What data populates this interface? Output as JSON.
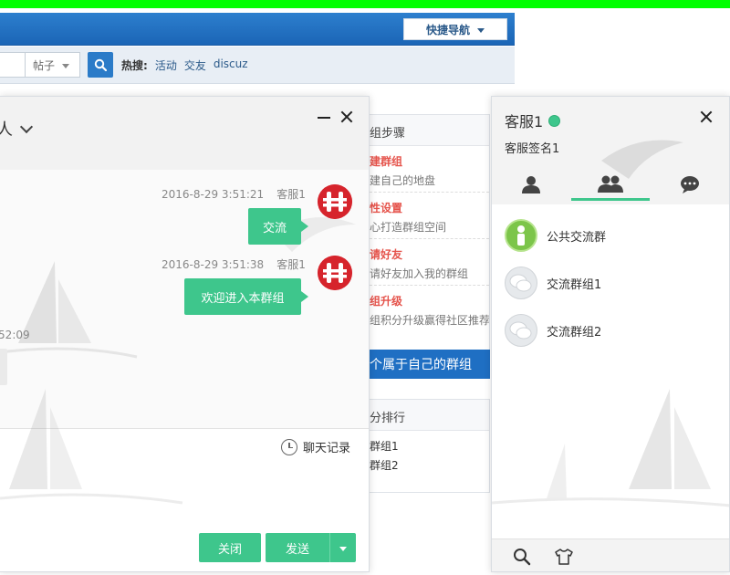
{
  "forum": {
    "quick_nav_label": "快捷导航",
    "search_scope": "帖子",
    "hot_label": "热搜:",
    "hot_links": [
      "活动",
      "交友",
      "discuz"
    ]
  },
  "steps": {
    "header": "组步骤",
    "items": [
      {
        "title": "建群组",
        "desc": "建自己的地盘"
      },
      {
        "title": "性设置",
        "desc": "心打造群组空间"
      },
      {
        "title": "请好友",
        "desc": "请好友加入我的群组"
      },
      {
        "title": "组升级",
        "desc": "组积分升级赢得社区推荐"
      }
    ],
    "create_button": "个属于自己的群组"
  },
  "ranking": {
    "header": "分排行",
    "items": [
      "群组1",
      "群组2"
    ]
  },
  "chat": {
    "title": "人",
    "messages": [
      {
        "time": "2016-8-29 3:51:21",
        "sender": "客服1",
        "text": "交流"
      },
      {
        "time": "2016-8-29 3:51:38",
        "sender": "客服1",
        "text": "欢迎进入本群组"
      }
    ],
    "older_time": ":52:09",
    "history_label": "聊天记录",
    "close_label": "关闭",
    "send_label": "发送"
  },
  "contact_panel": {
    "name": "客服1",
    "signature": "客服签名1",
    "groups": [
      "公共交流群",
      "交流群组1",
      "交流群组2"
    ]
  },
  "colors": {
    "accent_green": "#3ec68c",
    "forum_blue": "#1f6fc3",
    "step_red": "#e5534b"
  }
}
